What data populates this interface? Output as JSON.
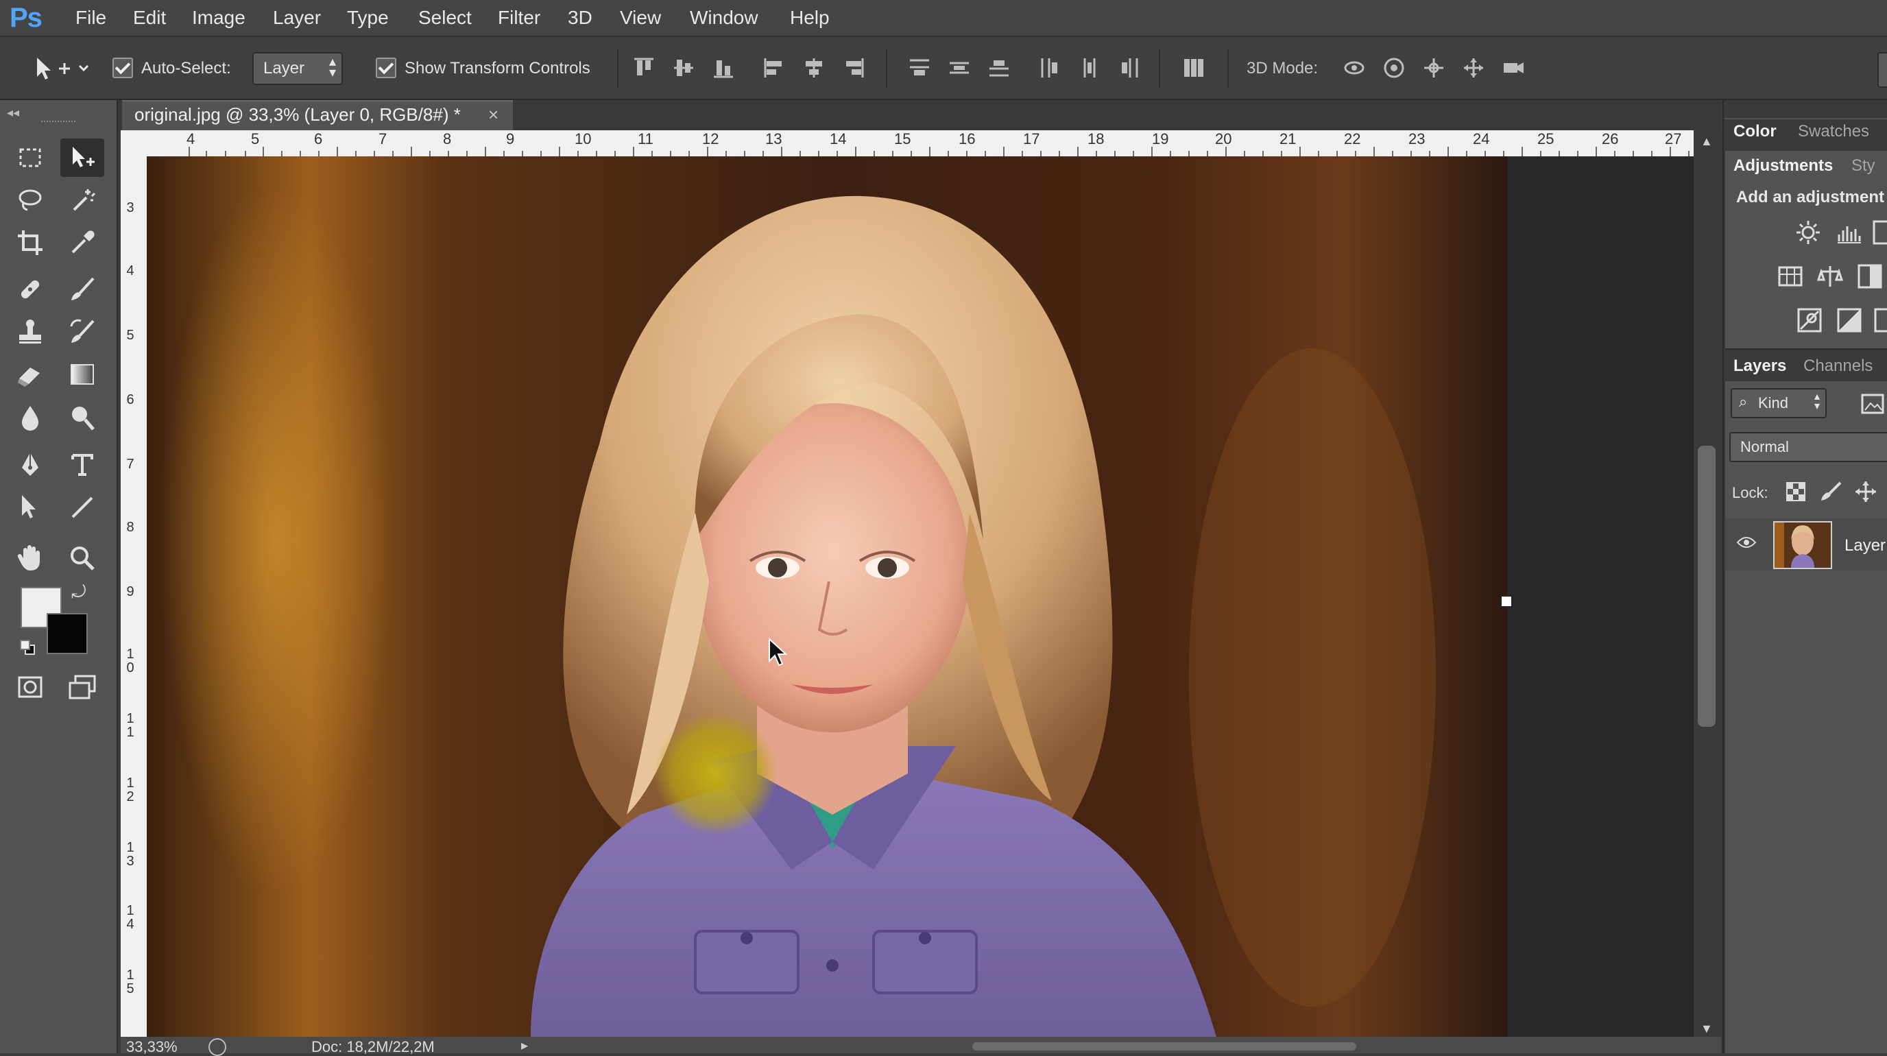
{
  "app": {
    "logo": "Ps"
  },
  "menu": [
    "File",
    "Edit",
    "Image",
    "Layer",
    "Type",
    "Select",
    "Filter",
    "3D",
    "View",
    "Window",
    "Help"
  ],
  "options": {
    "auto_select_label": "Auto-Select:",
    "auto_select_value": "Layer",
    "show_transform_label": "Show Transform Controls",
    "mode_3d_label": "3D Mode:"
  },
  "document": {
    "tab_title": "original.jpg @ 33,3% (Layer 0, RGB/8#) *",
    "close_glyph": "×"
  },
  "rulers": {
    "top": [
      "4",
      "5",
      "6",
      "7",
      "8",
      "9",
      "10",
      "11",
      "12",
      "13",
      "14",
      "15",
      "16",
      "17",
      "18",
      "19",
      "20",
      "21",
      "22",
      "23",
      "24",
      "25",
      "26",
      "27"
    ],
    "left": [
      "3",
      "4",
      "5",
      "6",
      "7",
      "8",
      "9",
      "1 0",
      "1 1",
      "1 2",
      "1 3",
      "1 4",
      "1 5"
    ]
  },
  "status": {
    "zoom": "33,33%",
    "doc": "Doc: 18,2M/22,2M"
  },
  "panels": {
    "color_tab": "Color",
    "swatches_tab": "Swatches",
    "adjustments_tab": "Adjustments",
    "styles_tab": "Sty",
    "adjustments_hint": "Add an adjustment",
    "layers_tab": "Layers",
    "channels_tab": "Channels",
    "filter_kind": "Kind",
    "blend_mode": "Normal",
    "lock_label": "Lock:",
    "layer_name": "Layer"
  }
}
